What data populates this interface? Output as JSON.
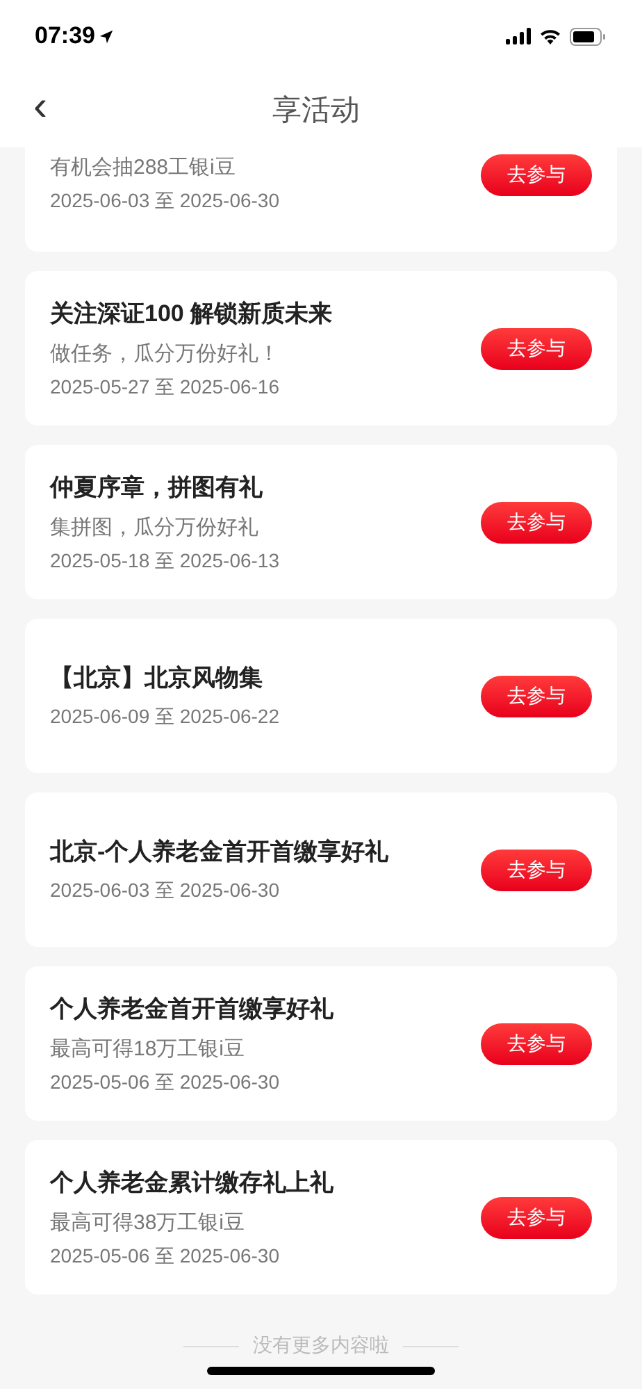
{
  "status_bar": {
    "time": "07:39"
  },
  "nav": {
    "back": "‹",
    "title": "享活动"
  },
  "activities": [
    {
      "subtitle": "有机会抽288工银i豆",
      "dates": "2025-06-03 至 2025-06-30",
      "button": "去参与"
    },
    {
      "title": "关注深证100 解锁新质未来",
      "subtitle": "做任务，瓜分万份好礼！",
      "dates": "2025-05-27 至 2025-06-16",
      "button": "去参与"
    },
    {
      "title": "仲夏序章，拼图有礼",
      "subtitle": "集拼图，瓜分万份好礼",
      "dates": "2025-05-18 至 2025-06-13",
      "button": "去参与"
    },
    {
      "title": "【北京】北京风物集",
      "dates": "2025-06-09 至 2025-06-22",
      "button": "去参与"
    },
    {
      "title": "北京-个人养老金首开首缴享好礼",
      "dates": "2025-06-03 至 2025-06-30",
      "button": "去参与"
    },
    {
      "title": "个人养老金首开首缴享好礼",
      "subtitle": "最高可得18万工银i豆",
      "dates": "2025-05-06 至 2025-06-30",
      "button": "去参与"
    },
    {
      "title": "个人养老金累计缴存礼上礼",
      "subtitle": "最高可得38万工银i豆",
      "dates": "2025-05-06 至 2025-06-30",
      "button": "去参与"
    }
  ],
  "footer": "没有更多内容啦"
}
